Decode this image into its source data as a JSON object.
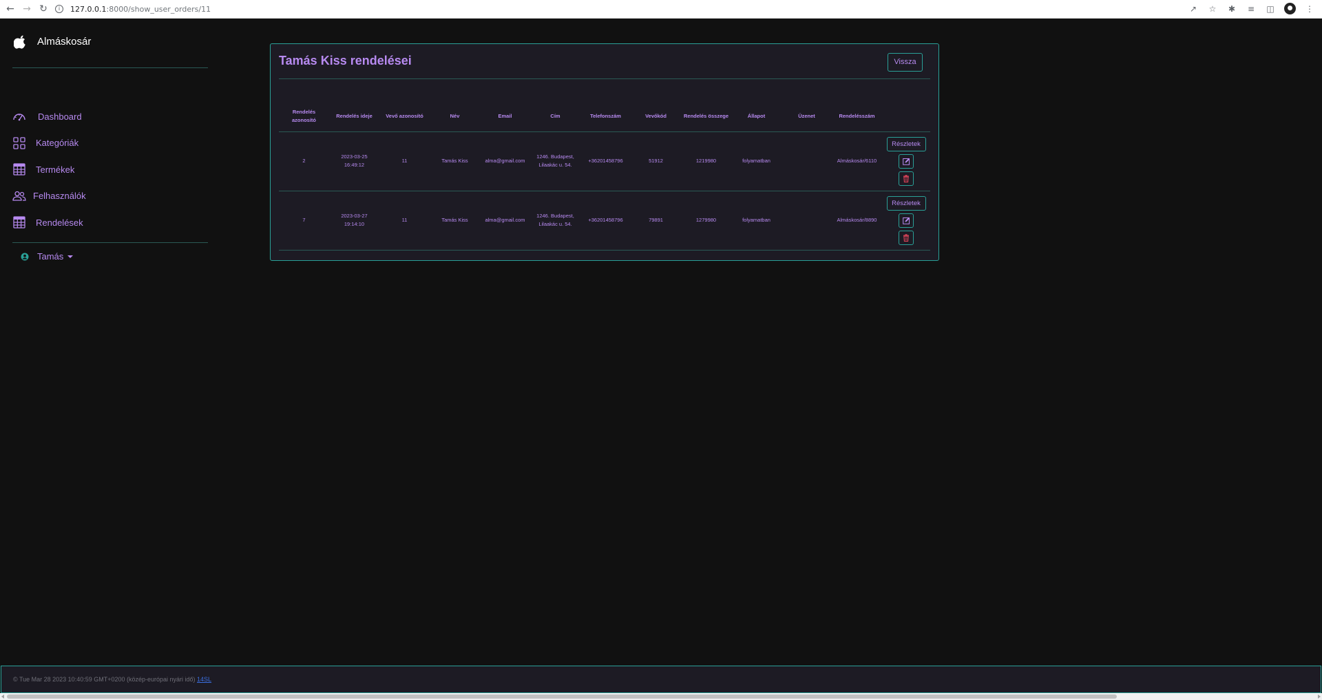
{
  "browser": {
    "url_host": "127.0.0.1",
    "url_path": ":8000/show_user_orders/11"
  },
  "sidebar": {
    "brand": "Almáskosár",
    "items": [
      {
        "label": "Dashboard",
        "icon": "speedometer-icon"
      },
      {
        "label": "Kategóriák",
        "icon": "grid-icon"
      },
      {
        "label": "Termékek",
        "icon": "table-icon"
      },
      {
        "label": "Felhasználók",
        "icon": "people-icon"
      },
      {
        "label": "Rendelések",
        "icon": "table-icon"
      }
    ],
    "user": "Tamás"
  },
  "page": {
    "title": "Tamás Kiss rendelései",
    "back_label": "Vissza"
  },
  "table": {
    "headers": [
      "Rendelés azonosító",
      "Rendelés ideje",
      "Vevő azonosító",
      "Név",
      "Email",
      "Cím",
      "Telefonszám",
      "Vevőkód",
      "Rendelés összege",
      "Állapot",
      "Üzenet",
      "Rendelésszám"
    ],
    "details_label": "Részletek",
    "rows": [
      {
        "id": "2",
        "time": "2023-03-25 16:49:12",
        "customer_id": "11",
        "name": "Tamás Kiss",
        "email": "alma@gmail.com",
        "address": "1246. Budapest, Lilaakác u. 54.",
        "phone": "+36201458796",
        "code": "51912",
        "total": "1219980",
        "status": "folyamatban",
        "message": "",
        "order_no": "Almáskosár/6110"
      },
      {
        "id": "7",
        "time": "2023-03-27 19:14:10",
        "customer_id": "11",
        "name": "Tamás Kiss",
        "email": "alma@gmail.com",
        "address": "1246. Budapest, Lilaakác u. 54.",
        "phone": "+36201458796",
        "code": "79891",
        "total": "1279980",
        "status": "folyamatban",
        "message": "",
        "order_no": "Almáskosár/8890"
      }
    ]
  },
  "footer": {
    "text": "© Tue Mar 28 2023 10:40:59 GMT+0200 (közép-európai nyári idő) ",
    "link": "14SL"
  },
  "colors": {
    "accent": "#b78af0",
    "border": "#2aa198",
    "danger": "#e0455a",
    "background": "#111111",
    "card": "#1d1b24"
  }
}
